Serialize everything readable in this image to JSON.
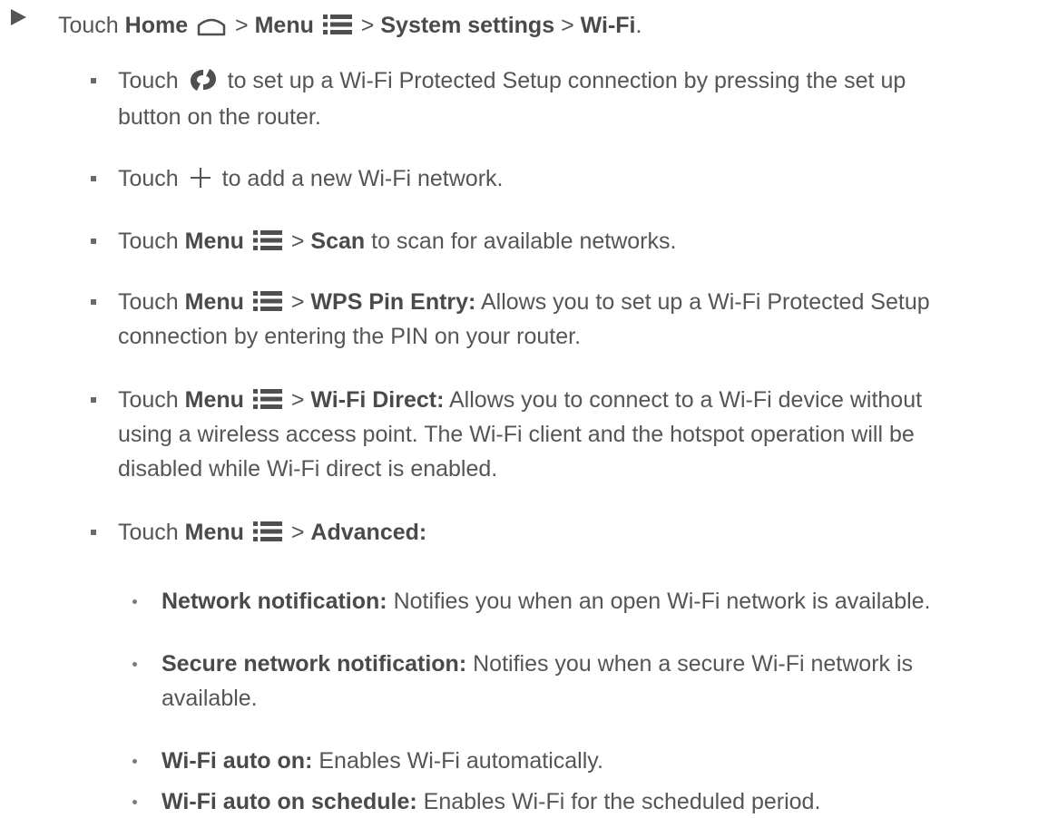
{
  "intro": {
    "touch": "Touch",
    "home": "Home",
    "sep1": ">",
    "menu": "Menu",
    "sep2": ">",
    "system_settings": "System settings",
    "sep3": ">",
    "wifi": "Wi-Fi",
    "end": "."
  },
  "items": {
    "wps": {
      "touch": "Touch",
      "line1": "to set up a Wi-Fi Protected Setup connection by pressing the set up",
      "line2": "button on the router."
    },
    "add": {
      "touch": "Touch",
      "text": "to add a new Wi-Fi network."
    },
    "scan": {
      "touch": "Touch",
      "menu": "Menu",
      "sep": ">",
      "label": "Scan",
      "text": "to scan for available networks."
    },
    "wps_pin": {
      "touch": "Touch",
      "menu": "Menu",
      "sep": ">",
      "label": "WPS Pin Entry:",
      "line1": "Allows you to set up a Wi-Fi Protected Setup",
      "line2": "connection by entering the PIN on your router."
    },
    "wifi_direct": {
      "touch": "Touch",
      "menu": "Menu",
      "sep": ">",
      "label": "Wi-Fi Direct:",
      "line1": "Allows you to connect to a Wi-Fi device without",
      "line2": "using a wireless access point. The Wi-Fi client and the hotspot operation will be",
      "line3": "disabled while Wi-Fi direct is enabled."
    },
    "advanced": {
      "touch": "Touch",
      "menu": "Menu",
      "sep": ">",
      "label": "Advanced:"
    }
  },
  "subitems": {
    "network_notification": {
      "label": "Network notification:",
      "text": "Notifies you when an open Wi-Fi network is available."
    },
    "secure_notification": {
      "label": "Secure network notification:",
      "line1": "Notifies you when a secure Wi-Fi network is",
      "line2": "available."
    },
    "auto_on": {
      "label": "Wi-Fi auto on:",
      "text": "Enables Wi-Fi automatically."
    },
    "auto_on_schedule": {
      "label": "Wi-Fi auto on schedule:",
      "text": "Enables Wi-Fi for the scheduled period."
    }
  },
  "icons": {
    "home": "home-icon",
    "menu": "menu-icon",
    "wps": "wps-icon",
    "add": "plus-icon"
  },
  "colors": {
    "text": "#555555",
    "bold": "#4a4a4a",
    "icon": "#4f4f4f"
  }
}
